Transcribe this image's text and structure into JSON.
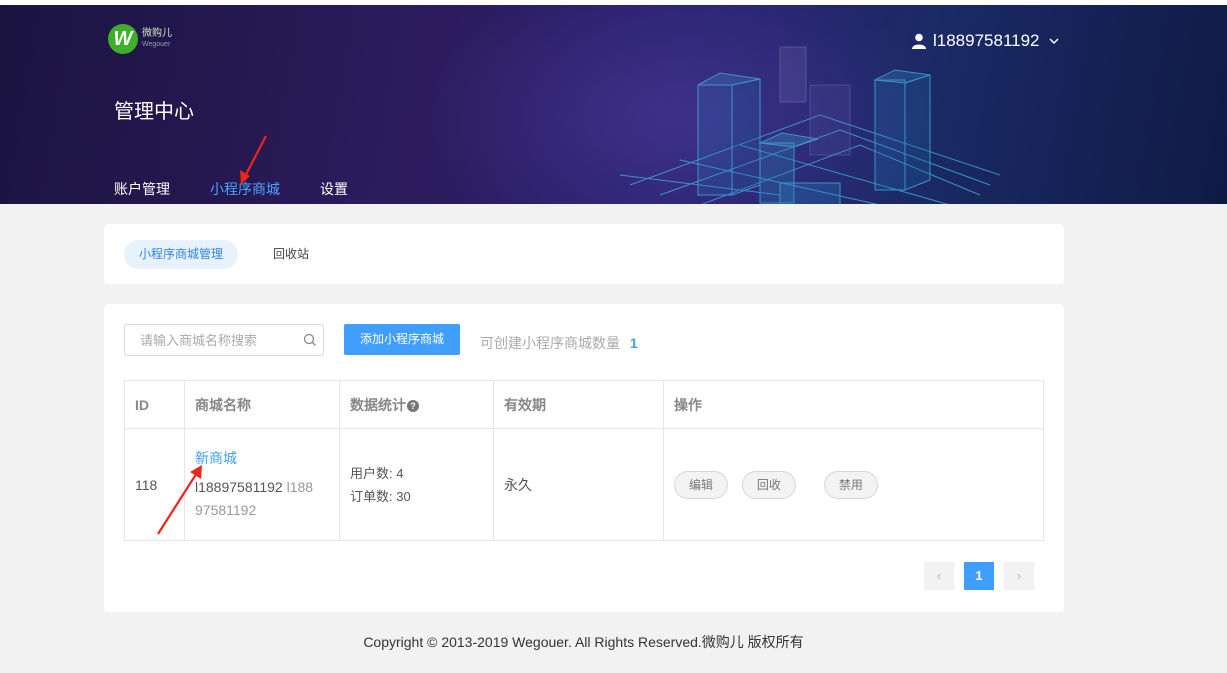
{
  "brand": {
    "name": "微购儿",
    "sub": "Wegouer",
    "mark": "W"
  },
  "user": {
    "name": "l18897581192"
  },
  "header": {
    "title": "管理中心"
  },
  "nav": [
    {
      "label": "账户管理",
      "active": false
    },
    {
      "label": "小程序商城",
      "active": true
    },
    {
      "label": "设置",
      "active": false
    }
  ],
  "subtabs": [
    {
      "label": "小程序商城管理",
      "active": true
    },
    {
      "label": "回收站",
      "active": false
    }
  ],
  "toolbar": {
    "search_placeholder": "请输入商城名称搜索",
    "add_label": "添加小程序商城",
    "quota_label": "可创建小程序商城数量",
    "quota_value": "1"
  },
  "table": {
    "headers": [
      "ID",
      "商城名称",
      "数据统计",
      "有效期",
      "操作"
    ],
    "help_glyph": "?",
    "rows": [
      {
        "id": "118",
        "name": "新商城",
        "owner": "l18897581192",
        "owner_extra_1": "l188",
        "owner_extra_2": "97581192",
        "users": "用户数: 4",
        "orders": "订单数: 30",
        "validity": "永久",
        "actions": [
          "编辑",
          "回收",
          "禁用"
        ]
      }
    ]
  },
  "pagination": {
    "prev": "‹",
    "current": "1",
    "next": "›"
  },
  "footer": {
    "text": "Copyright © 2013-2019 Wegouer. All Rights Reserved.微购儿 版权所有"
  },
  "colors": {
    "accent": "#409eff",
    "header_bg": "#2a2270",
    "annotation_red": "#f0241b"
  }
}
